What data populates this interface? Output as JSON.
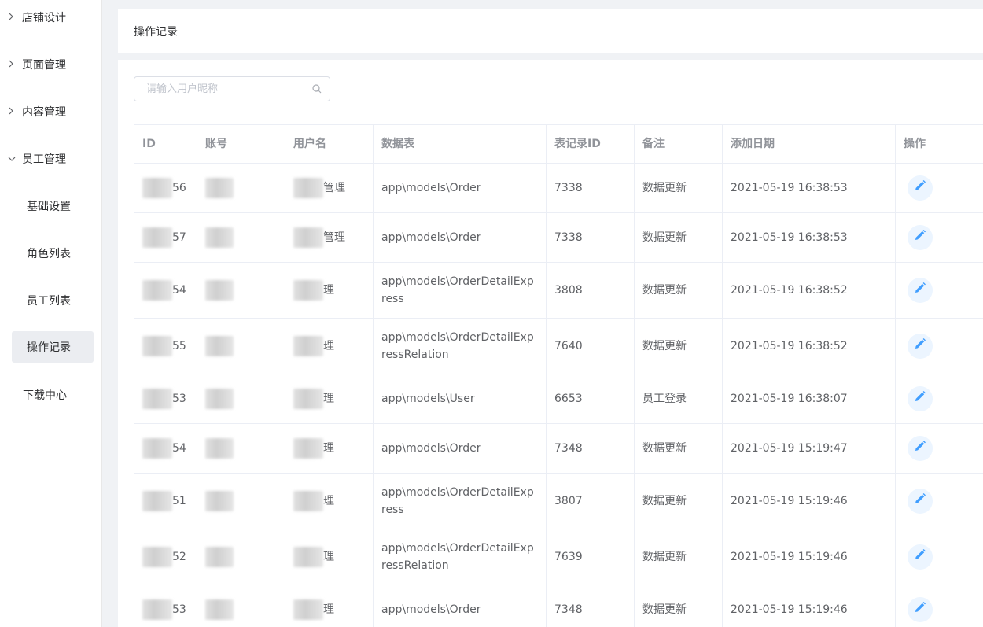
{
  "sidebar": {
    "groups": [
      {
        "label": "店铺设计",
        "expanded": false
      },
      {
        "label": "页面管理",
        "expanded": false
      },
      {
        "label": "内容管理",
        "expanded": false
      },
      {
        "label": "员工管理",
        "expanded": true
      }
    ],
    "sub_items": [
      {
        "label": "基础设置",
        "active": false
      },
      {
        "label": "角色列表",
        "active": false
      },
      {
        "label": "员工列表",
        "active": false
      },
      {
        "label": "操作记录",
        "active": true
      }
    ],
    "bottom_item": "下载中心"
  },
  "header": {
    "title": "操作记录"
  },
  "search": {
    "placeholder": "请输入用户昵称",
    "value": ""
  },
  "table": {
    "columns": [
      "ID",
      "账号",
      "用户名",
      "数据表",
      "表记录ID",
      "备注",
      "添加日期",
      "操作"
    ],
    "rows": [
      {
        "id": "56",
        "account": "",
        "username": "管理",
        "table": "app\\models\\Order",
        "record_id": "7338",
        "note": "数据更新",
        "date": "2021-05-19 16:38:53"
      },
      {
        "id": "57",
        "account": "",
        "username": "管理",
        "table": "app\\models\\Order",
        "record_id": "7338",
        "note": "数据更新",
        "date": "2021-05-19 16:38:53"
      },
      {
        "id": "54",
        "account": "",
        "username": "理",
        "table": "app\\models\\OrderDetailExpress",
        "record_id": "3808",
        "note": "数据更新",
        "date": "2021-05-19 16:38:52"
      },
      {
        "id": "55",
        "account": "",
        "username": "理",
        "table": "app\\models\\OrderDetailExpressRelation",
        "record_id": "7640",
        "note": "数据更新",
        "date": "2021-05-19 16:38:52"
      },
      {
        "id": "53",
        "account": "",
        "username": "理",
        "table": "app\\models\\User",
        "record_id": "6653",
        "note": "员工登录",
        "date": "2021-05-19 16:38:07"
      },
      {
        "id": "54",
        "account": "",
        "username": "理",
        "table": "app\\models\\Order",
        "record_id": "7348",
        "note": "数据更新",
        "date": "2021-05-19 15:19:47"
      },
      {
        "id": "51",
        "account": "",
        "username": "理",
        "table": "app\\models\\OrderDetailExpress",
        "record_id": "3807",
        "note": "数据更新",
        "date": "2021-05-19 15:19:46"
      },
      {
        "id": "52",
        "account": "",
        "username": "理",
        "table": "app\\models\\OrderDetailExpressRelation",
        "record_id": "7639",
        "note": "数据更新",
        "date": "2021-05-19 15:19:46"
      },
      {
        "id": "53",
        "account": "",
        "username": "理",
        "table": "app\\models\\Order",
        "record_id": "7348",
        "note": "数据更新",
        "date": "2021-05-19 15:19:46"
      }
    ]
  },
  "colors": {
    "accent": "#409eff",
    "edit_bg": "#ecf5ff",
    "active_bg": "#ebedf1"
  },
  "icons": {
    "collapsed": "chevron-right-icon",
    "expanded": "chevron-down-icon",
    "search": "search-icon",
    "edit": "pencil-icon"
  }
}
